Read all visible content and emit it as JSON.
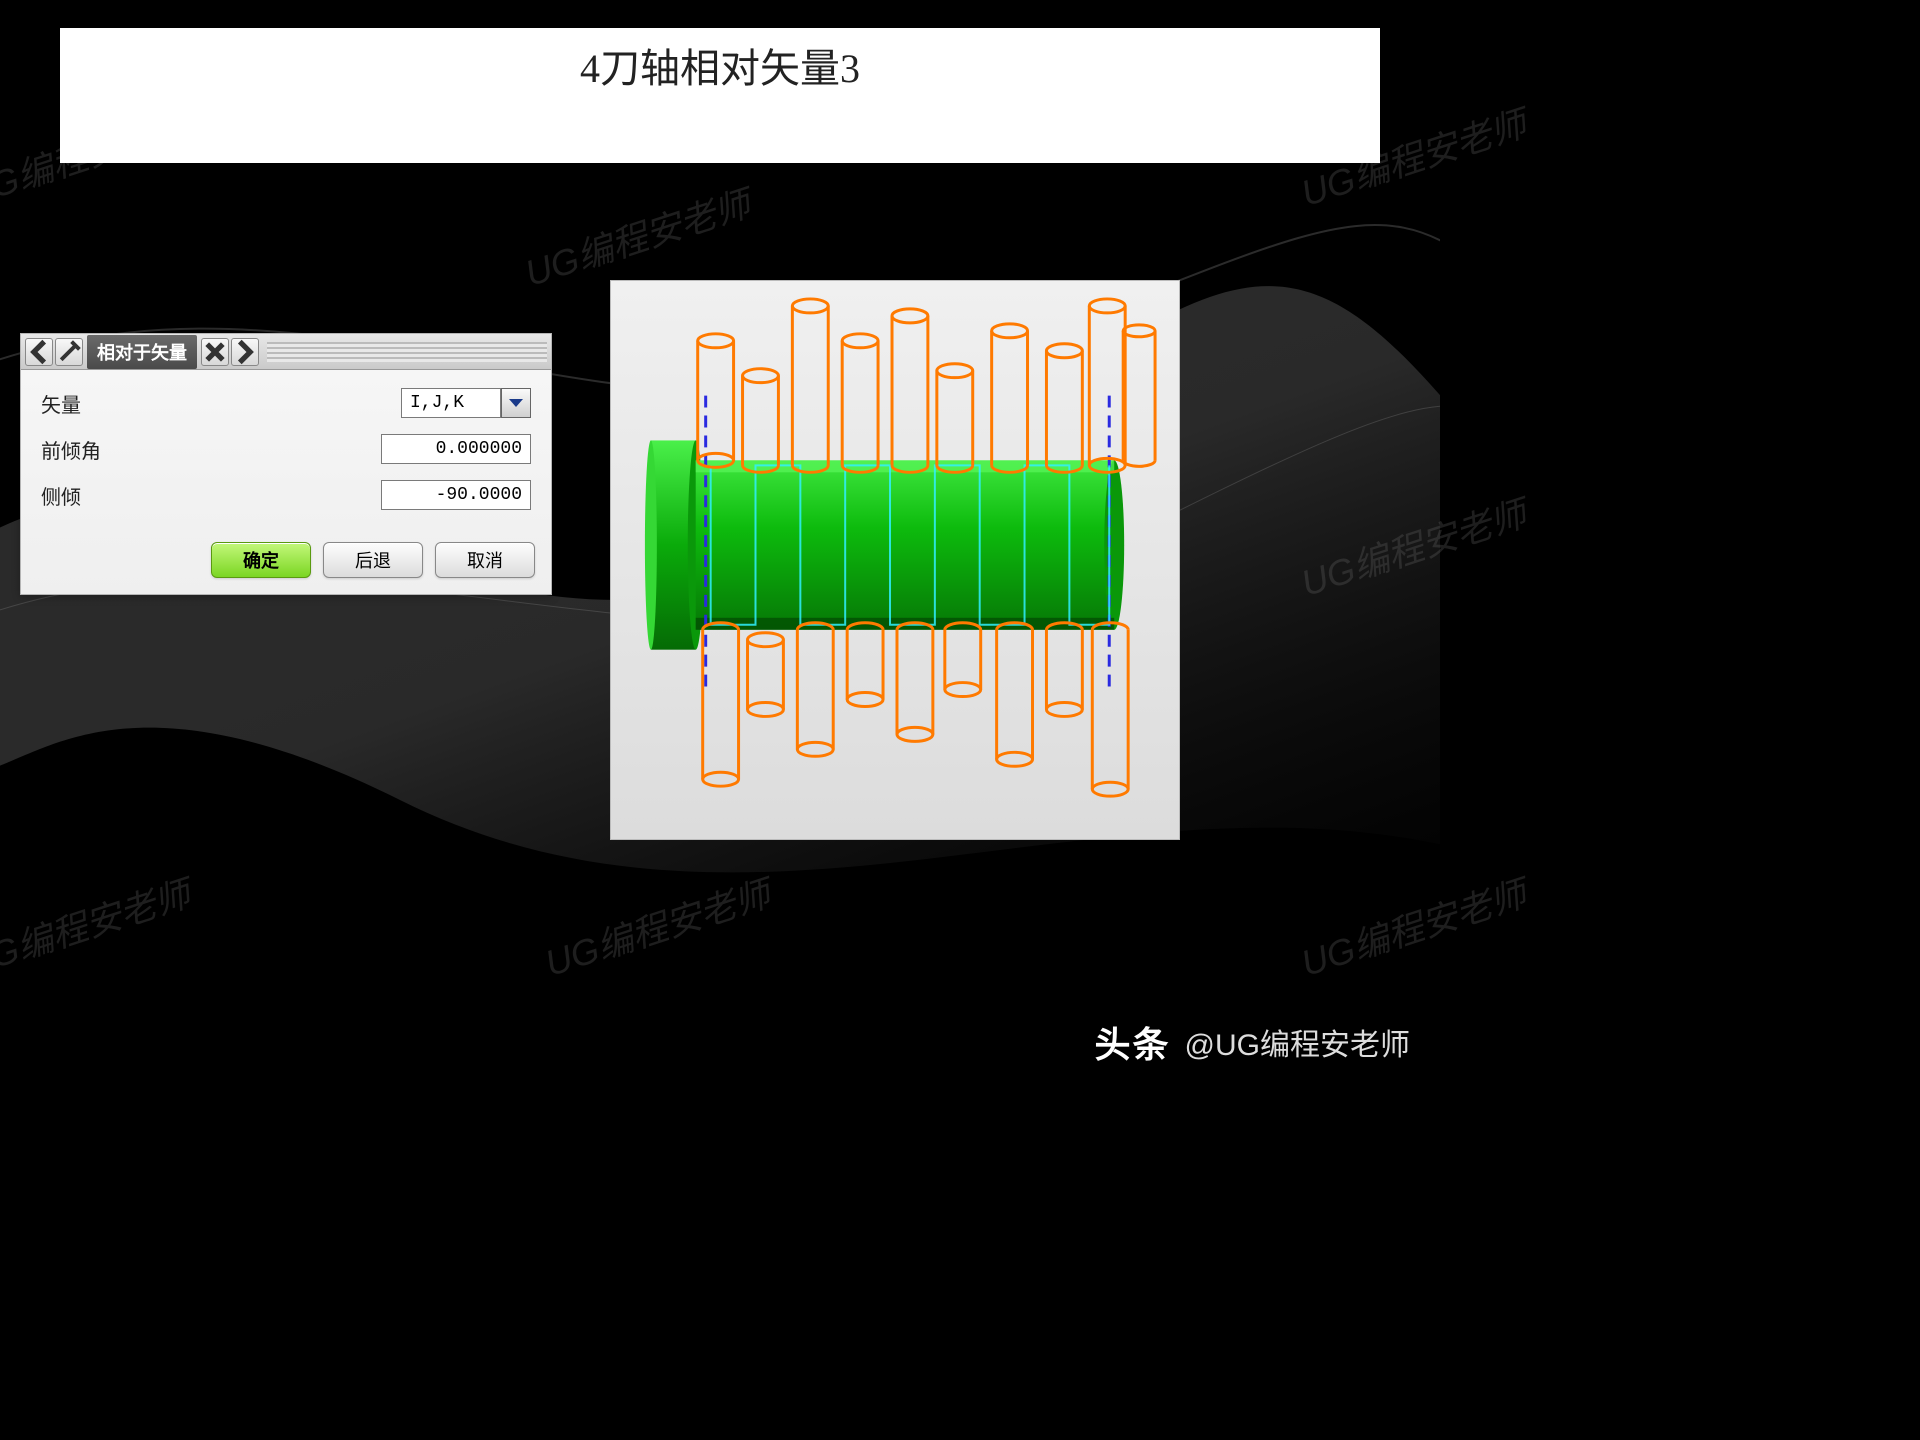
{
  "title": "4刀轴相对矢量3",
  "watermark_text": "UG编程安老师",
  "dialog": {
    "title": "相对于矢量",
    "vector_label": "矢量",
    "vector_value": "I,J,K",
    "lead_label": "前倾角",
    "lead_value": "0.000000",
    "tilt_label": "侧倾",
    "tilt_value": "-90.0000",
    "ok_label": "确定",
    "back_label": "后退",
    "cancel_label": "取消"
  },
  "footer": {
    "brand": "头条",
    "author": "@UG编程安老师"
  },
  "colors": {
    "tool_path": "#ff7a00",
    "boundary": "#3a3aff",
    "surface": "#0dbb0d",
    "surface_dark": "#078a07",
    "toolpath_cyan": "#30f0ff"
  }
}
